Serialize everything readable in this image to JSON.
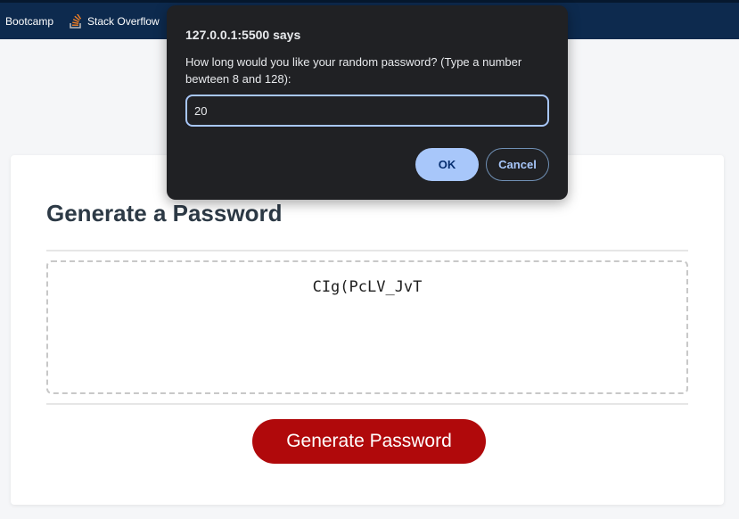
{
  "bookmarks": [
    {
      "label": "Bootcamp"
    },
    {
      "label": "Stack Overflow",
      "icon": "stack-overflow-icon"
    }
  ],
  "card": {
    "title": "Generate a Password",
    "password": "CIg(PcLV_JvT",
    "generate_label": "Generate Password"
  },
  "dialog": {
    "origin": "127.0.0.1:5500 says",
    "message": "How long would you like your random password? (Type a number bewteen 8 and 128):",
    "input_value": "20",
    "ok_label": "OK",
    "cancel_label": "Cancel"
  },
  "colors": {
    "bookmarks_bar": "#0d2a4e",
    "generate_button": "#b0090b",
    "dialog_background": "#202124",
    "dialog_accent": "#a8c7fa"
  }
}
